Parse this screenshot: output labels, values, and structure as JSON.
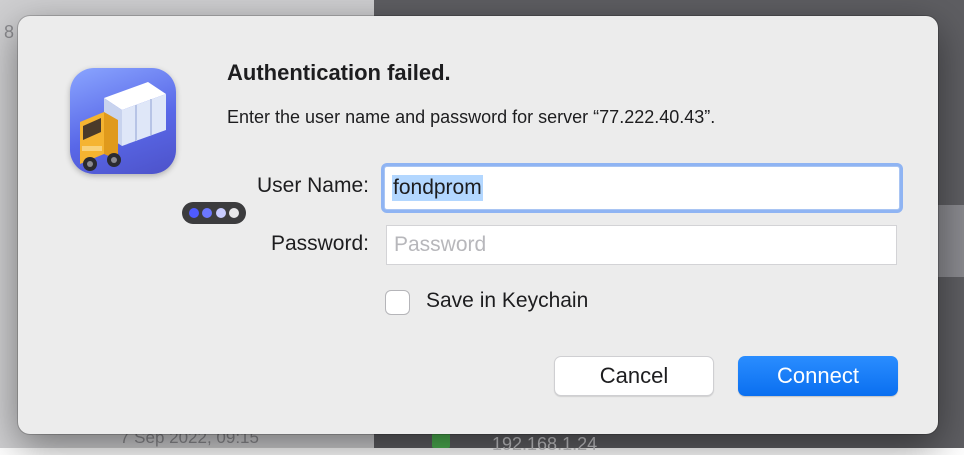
{
  "background": {
    "left_number": "8",
    "bottom_date": "7 Sep 2022, 09:15",
    "bottom_ip": "192.168.1.24"
  },
  "dialog": {
    "app_icon": "transmit-truck-icon",
    "title": "Authentication failed.",
    "message": "Enter the user name and password for server “77.222.40.43”.",
    "username_label": "User Name:",
    "username_value": "fondprom",
    "password_label": "Password:",
    "password_placeholder": "Password",
    "password_value": "",
    "save_keychain_label": "Save in Keychain",
    "save_keychain_checked": false,
    "cancel_label": "Cancel",
    "connect_label": "Connect"
  },
  "colors": {
    "accent": "#0a6ff0",
    "focus_ring": "#8fb4f3",
    "selection": "#b3d7ff",
    "icon_gradient_top": "#8aa5ff",
    "icon_gradient_bottom": "#4d52c9"
  }
}
